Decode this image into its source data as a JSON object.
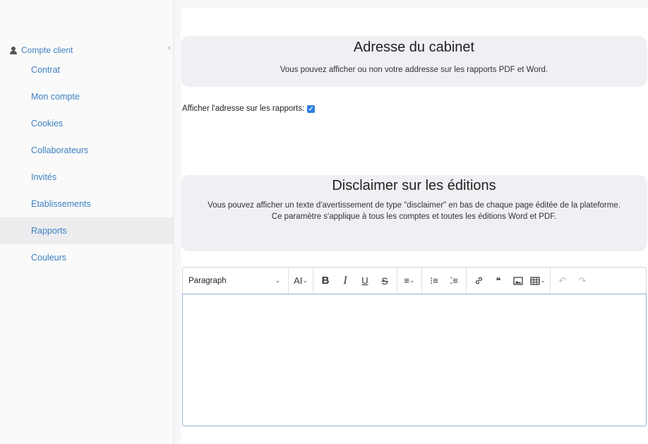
{
  "sidebar": {
    "header": {
      "label": "Compte client",
      "icon": "user-icon"
    },
    "collapse_icon": "‹",
    "items": [
      {
        "label": "Contrat",
        "active": false
      },
      {
        "label": "Mon compte",
        "active": false
      },
      {
        "label": "Cookies",
        "active": false
      },
      {
        "label": "Collaborateurs",
        "active": false
      },
      {
        "label": "Invités",
        "active": false
      },
      {
        "label": "Etablissements",
        "active": false
      },
      {
        "label": "Rapports",
        "active": true
      },
      {
        "label": "Couleurs",
        "active": false
      }
    ]
  },
  "address_section": {
    "title": "Adresse du cabinet",
    "description": "Vous pouvez afficher ou non votre addresse sur les rapports PDF et Word.",
    "checkbox_label": "Afficher l'adresse sur les rapports:",
    "checkbox_checked": true
  },
  "disclaimer_section": {
    "title": "Disclaimer sur les éditions",
    "description_line1": "Vous pouvez afficher un texte d'avertissement de type \"disclaimer\" en bas de chaque page éditée de la plateforme.",
    "description_line2": "Ce paramètre s'applique à tous les comptes et toutes les éditions Word et PDF."
  },
  "editor": {
    "paragraph_select": "Paragraph",
    "toolbar": {
      "font_size": "AI",
      "bold": "B",
      "italic": "I",
      "underline": "U",
      "strikethrough": "S",
      "align": "≡",
      "numbered_list": "⁝≡",
      "bulleted_list": "⁚≡",
      "link": "🔗",
      "quote": "❝",
      "image": "▣",
      "table": "▦",
      "undo": "↶",
      "redo": "↷"
    },
    "content": ""
  },
  "colors": {
    "link": "#3d7fc0",
    "panel_bg": "#eef0f3",
    "checkbox": "#2f7fe0",
    "editor_focus_border": "#8fb4de"
  }
}
